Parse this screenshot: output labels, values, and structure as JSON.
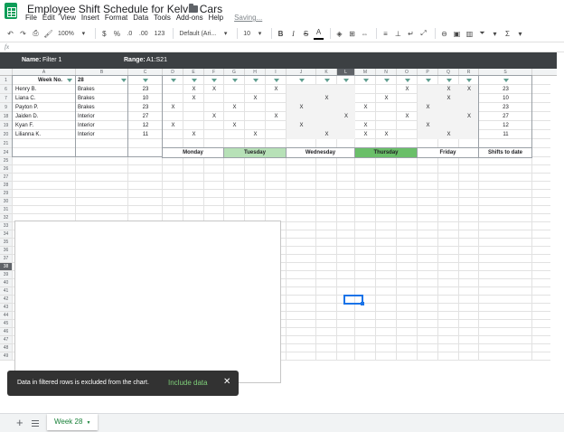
{
  "title": "Employee Shift Schedule for Kelvin Cars",
  "menu": [
    "File",
    "Edit",
    "View",
    "Insert",
    "Format",
    "Data",
    "Tools",
    "Add-ons",
    "Help"
  ],
  "saving": "Saving...",
  "toolbar": {
    "zoom": "100%",
    "currency": "$",
    "percent": "%",
    "dec_less": ".0",
    "dec_more": ".00",
    "more_formats": "123",
    "font": "Default (Ari...",
    "font_size": "10",
    "bold": "B",
    "italic": "I",
    "strike": "S",
    "text_color": "A"
  },
  "formula_bar": {
    "fx": "fx"
  },
  "filter": {
    "name_label": "Name:",
    "name_value": "Filter 1",
    "range_label": "Range:",
    "range_value": "A1:S21"
  },
  "columns": [
    "A",
    "B",
    "C",
    "D",
    "E",
    "F",
    "G",
    "H",
    "I",
    "J",
    "K",
    "L",
    "M",
    "N",
    "O",
    "P",
    "Q",
    "R",
    "S"
  ],
  "selected_column": "L",
  "row_numbers": [
    "1",
    "6",
    "7",
    "9",
    "18",
    "19",
    "20",
    "21",
    "24",
    "25",
    "26",
    "27",
    "28",
    "29",
    "30",
    "31",
    "32",
    "33",
    "34",
    "35",
    "36",
    "37",
    "38",
    "39",
    "40",
    "41",
    "42",
    "43",
    "44",
    "45",
    "46",
    "47",
    "48",
    "49"
  ],
  "selected_row": "38",
  "header_row": {
    "week_label": "Week No.",
    "week_value": "28"
  },
  "employees": [
    {
      "name": "Henry B.",
      "dept": "Brakes",
      "shifts": "23",
      "total": "23",
      "x": [
        "E",
        "F",
        "I",
        "O",
        "Q",
        "R"
      ]
    },
    {
      "name": "Liana C.",
      "dept": "Brakes",
      "shifts": "10",
      "total": "10",
      "x": [
        "E",
        "H",
        "K",
        "N",
        "Q"
      ]
    },
    {
      "name": "Payton P.",
      "dept": "Brakes",
      "shifts": "23",
      "total": "23",
      "x": [
        "D",
        "G",
        "J",
        "M",
        "P"
      ]
    },
    {
      "name": "Jaiden D.",
      "dept": "Interior",
      "shifts": "27",
      "total": "27",
      "x": [
        "F",
        "I",
        "L",
        "O",
        "R"
      ]
    },
    {
      "name": "Kyan F.",
      "dept": "Interior",
      "shifts": "12",
      "total": "12",
      "x": [
        "D",
        "G",
        "J",
        "M",
        "P"
      ]
    },
    {
      "name": "Lilianna K.",
      "dept": "Interior",
      "shifts": "11",
      "total": "11",
      "x": [
        "E",
        "H",
        "K",
        "M",
        "N",
        "Q"
      ]
    }
  ],
  "mark": "X",
  "days": [
    "Monday",
    "Tuesday",
    "Wednesday",
    "Thursday",
    "Friday"
  ],
  "shifts_to_date": "Shifts to date",
  "snackbar": {
    "message": "Data in filtered rows is excluded from the chart.",
    "action": "Include data",
    "close": "✕"
  },
  "sheet_tab": {
    "label": "Week 28",
    "caret": "▼"
  },
  "bottom": {
    "add": "+"
  }
}
